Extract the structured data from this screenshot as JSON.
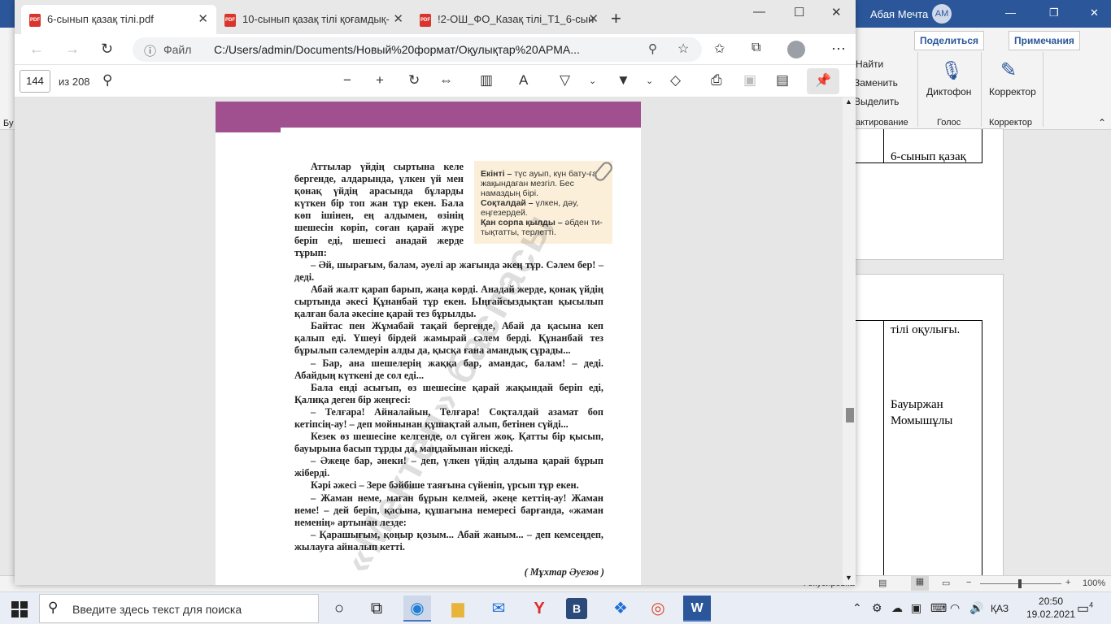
{
  "word": {
    "user_name": "Абая Мечта",
    "user_initials": "AM",
    "share_label": "Поделиться",
    "comments_label": "Примечания",
    "find_label": "Найти",
    "replace_label": "Заменить",
    "select_label": "Выделить",
    "dictate_label": "Диктофон",
    "editor_label": "Корректор",
    "group_editing": "актирование",
    "group_voice": "Голос",
    "group_editor": "Корректор",
    "left_clip": "Бу",
    "cell_1": "6-сынып қазақ",
    "cell_2": "тілі оқулығы.",
    "cell_3": "Бауыржан",
    "cell_4": "Момышұлы",
    "status_focus": "Фокусировка",
    "zoom": "100%"
  },
  "edge": {
    "tabs": [
      {
        "title": "6-сынып қазақ тілі.pdf",
        "active": true
      },
      {
        "title": "10-сынып қазақ тілі қоғамдық-",
        "active": false
      },
      {
        "title": "!2-ОШ_ФО_Казақ тілі_Т1_6-сын",
        "active": false
      }
    ],
    "url_label": "Файл",
    "url": "C:/Users/admin/Documents/Новый%20формат/Оқулықтар%20АРМА...",
    "page_current": "144",
    "page_total": "из 208"
  },
  "pdf": {
    "glossary": [
      {
        "term": "Екінті –",
        "def": " түс ауып, күн бату-ға жақындаған мезгіл. Бес намаздың бірі."
      },
      {
        "term": "Соқталдай –",
        "def": " үлкен, дәу, еңгезердей."
      },
      {
        "term": "Қан сорпа қылды –",
        "def": " әбден ти-тықтатты, терлетті."
      }
    ],
    "paragraphs": [
      "Аттылар үйдің сыртына келе бергенде, алдарында, үлкен үй мен қонақ үйдің арасында бұларды күткен бір топ жан тұр екен. Бала көп ішінен, ең алдымен, өзінің шешесін көріп, соған қарай жүре беріп еді, шешесі анадай жерде тұрып:",
      "– Әй, шырағым, балам, әуелі ар жағында әкең тұр. Сәлем бер! – деді.",
      "Абай жалт қарап барып, жаңа көрді. Анадай жерде, қонақ үйдің сыртында әкесі Құнанбай тұр екен. Ыңғайсыздықтан қысылып қалған бала әкесіне қарай тез бұрылды.",
      "Байтас пен Жұмабай тақай бергенде, Абай да қасына кеп қалып еді. Үшеуі бірдей жамырай сәлем берді. Құнанбай тез бұрылып сәлемдерін алды да, қысқа ғана амандық сұрады...",
      "– Бар, ана шешелерің жаққа бар, амандас, балам! – деді. Абайдың күткені де сол еді...",
      "Бала енді асығып, өз шешесіне қарай жақындай беріп еді, Қалиқа деген бір жеңгесі:",
      "– Телғара! Айналайын, Телғара! Соқталдай азамат боп кетіпсің-ау! – деп мойнынан құшақтай алып, бетінен сүйді...",
      "Кезек өз шешесіне келгенде, ол сүйген жоқ. Қатты бір қысып, бауырына басып тұрды да, маңдайынан иіскеді.",
      "– Әжеңе бар, әнеки! – деп, үлкен үйдің алдына қарай бұрып жіберді.",
      "Кәрі әжесі – Зере бәйбіше таяғына сүйеніп, үрсып тұр екен.",
      "– Жаман неме, маған бұрын келмей, әкеңе кеттің-ау! Жаман неме! – дей беріп, қасына, құшағына немересі барғанда, «жаман неменің» артынан лезде:",
      "– Қарашығым, қоңыр қозым... Абай жаным... – деп кемсеңдеп, жылауға айналып кетті."
    ],
    "author": "( Мұхтар Әуезов )",
    "watermark": "«Мектеп» баспасы"
  },
  "taskbar": {
    "search_placeholder": "Введите здесь текст для поиска",
    "language": "ҚАЗ",
    "time": "20:50",
    "date": "19.02.2021",
    "notifications": "4"
  }
}
